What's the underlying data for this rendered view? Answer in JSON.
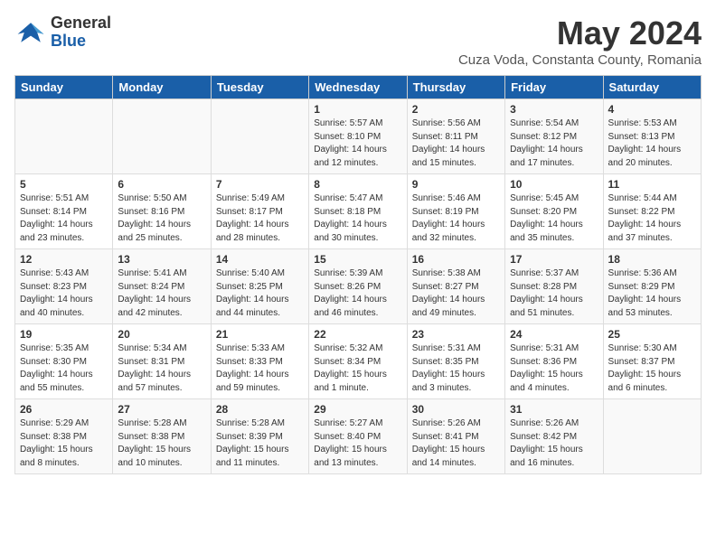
{
  "header": {
    "logo_general": "General",
    "logo_blue": "Blue",
    "month_title": "May 2024",
    "location": "Cuza Voda, Constanta County, Romania"
  },
  "days_of_week": [
    "Sunday",
    "Monday",
    "Tuesday",
    "Wednesday",
    "Thursday",
    "Friday",
    "Saturday"
  ],
  "weeks": [
    [
      {
        "day": "",
        "info": ""
      },
      {
        "day": "",
        "info": ""
      },
      {
        "day": "",
        "info": ""
      },
      {
        "day": "1",
        "info": "Sunrise: 5:57 AM\nSunset: 8:10 PM\nDaylight: 14 hours and 12 minutes."
      },
      {
        "day": "2",
        "info": "Sunrise: 5:56 AM\nSunset: 8:11 PM\nDaylight: 14 hours and 15 minutes."
      },
      {
        "day": "3",
        "info": "Sunrise: 5:54 AM\nSunset: 8:12 PM\nDaylight: 14 hours and 17 minutes."
      },
      {
        "day": "4",
        "info": "Sunrise: 5:53 AM\nSunset: 8:13 PM\nDaylight: 14 hours and 20 minutes."
      }
    ],
    [
      {
        "day": "5",
        "info": "Sunrise: 5:51 AM\nSunset: 8:14 PM\nDaylight: 14 hours and 23 minutes."
      },
      {
        "day": "6",
        "info": "Sunrise: 5:50 AM\nSunset: 8:16 PM\nDaylight: 14 hours and 25 minutes."
      },
      {
        "day": "7",
        "info": "Sunrise: 5:49 AM\nSunset: 8:17 PM\nDaylight: 14 hours and 28 minutes."
      },
      {
        "day": "8",
        "info": "Sunrise: 5:47 AM\nSunset: 8:18 PM\nDaylight: 14 hours and 30 minutes."
      },
      {
        "day": "9",
        "info": "Sunrise: 5:46 AM\nSunset: 8:19 PM\nDaylight: 14 hours and 32 minutes."
      },
      {
        "day": "10",
        "info": "Sunrise: 5:45 AM\nSunset: 8:20 PM\nDaylight: 14 hours and 35 minutes."
      },
      {
        "day": "11",
        "info": "Sunrise: 5:44 AM\nSunset: 8:22 PM\nDaylight: 14 hours and 37 minutes."
      }
    ],
    [
      {
        "day": "12",
        "info": "Sunrise: 5:43 AM\nSunset: 8:23 PM\nDaylight: 14 hours and 40 minutes."
      },
      {
        "day": "13",
        "info": "Sunrise: 5:41 AM\nSunset: 8:24 PM\nDaylight: 14 hours and 42 minutes."
      },
      {
        "day": "14",
        "info": "Sunrise: 5:40 AM\nSunset: 8:25 PM\nDaylight: 14 hours and 44 minutes."
      },
      {
        "day": "15",
        "info": "Sunrise: 5:39 AM\nSunset: 8:26 PM\nDaylight: 14 hours and 46 minutes."
      },
      {
        "day": "16",
        "info": "Sunrise: 5:38 AM\nSunset: 8:27 PM\nDaylight: 14 hours and 49 minutes."
      },
      {
        "day": "17",
        "info": "Sunrise: 5:37 AM\nSunset: 8:28 PM\nDaylight: 14 hours and 51 minutes."
      },
      {
        "day": "18",
        "info": "Sunrise: 5:36 AM\nSunset: 8:29 PM\nDaylight: 14 hours and 53 minutes."
      }
    ],
    [
      {
        "day": "19",
        "info": "Sunrise: 5:35 AM\nSunset: 8:30 PM\nDaylight: 14 hours and 55 minutes."
      },
      {
        "day": "20",
        "info": "Sunrise: 5:34 AM\nSunset: 8:31 PM\nDaylight: 14 hours and 57 minutes."
      },
      {
        "day": "21",
        "info": "Sunrise: 5:33 AM\nSunset: 8:33 PM\nDaylight: 14 hours and 59 minutes."
      },
      {
        "day": "22",
        "info": "Sunrise: 5:32 AM\nSunset: 8:34 PM\nDaylight: 15 hours and 1 minute."
      },
      {
        "day": "23",
        "info": "Sunrise: 5:31 AM\nSunset: 8:35 PM\nDaylight: 15 hours and 3 minutes."
      },
      {
        "day": "24",
        "info": "Sunrise: 5:31 AM\nSunset: 8:36 PM\nDaylight: 15 hours and 4 minutes."
      },
      {
        "day": "25",
        "info": "Sunrise: 5:30 AM\nSunset: 8:37 PM\nDaylight: 15 hours and 6 minutes."
      }
    ],
    [
      {
        "day": "26",
        "info": "Sunrise: 5:29 AM\nSunset: 8:38 PM\nDaylight: 15 hours and 8 minutes."
      },
      {
        "day": "27",
        "info": "Sunrise: 5:28 AM\nSunset: 8:38 PM\nDaylight: 15 hours and 10 minutes."
      },
      {
        "day": "28",
        "info": "Sunrise: 5:28 AM\nSunset: 8:39 PM\nDaylight: 15 hours and 11 minutes."
      },
      {
        "day": "29",
        "info": "Sunrise: 5:27 AM\nSunset: 8:40 PM\nDaylight: 15 hours and 13 minutes."
      },
      {
        "day": "30",
        "info": "Sunrise: 5:26 AM\nSunset: 8:41 PM\nDaylight: 15 hours and 14 minutes."
      },
      {
        "day": "31",
        "info": "Sunrise: 5:26 AM\nSunset: 8:42 PM\nDaylight: 15 hours and 16 minutes."
      },
      {
        "day": "",
        "info": ""
      }
    ]
  ]
}
